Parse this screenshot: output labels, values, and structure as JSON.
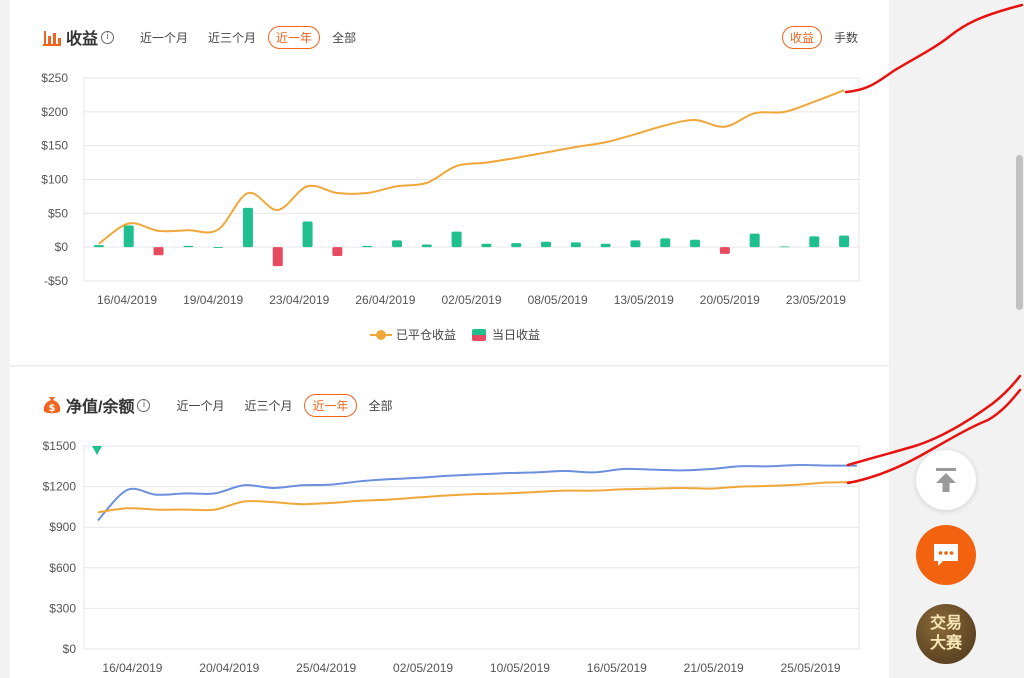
{
  "income_panel": {
    "title": "收益",
    "info": "i",
    "tabs": [
      "近一个月",
      "近三个月",
      "近一年",
      "全部"
    ],
    "active_tab": 2,
    "toggle": [
      "收益",
      "手数"
    ],
    "active_toggle": 0,
    "legend": [
      "已平仓收益",
      "当日收益"
    ]
  },
  "nav_panel": {
    "title": "净值/余额",
    "info": "i",
    "tabs": [
      "近一个月",
      "近三个月",
      "近一年",
      "全部"
    ],
    "active_tab": 2
  },
  "float_buttons": {
    "contest_line1": "交易",
    "contest_line2": "大赛"
  },
  "colors": {
    "accent": "#f0651f",
    "closed_income": "#f0a73a",
    "positive_bar": "#1fbf8f",
    "negative_bar": "#e84a5f",
    "net_value": "#6b8fdc",
    "balance": "#f0a73a",
    "annotation": "#e8110e"
  },
  "chart_data": [
    {
      "type": "bar",
      "y_tick_labels": [
        "$250",
        "$200",
        "$150",
        "$100",
        "$50",
        "$0",
        "-$50"
      ],
      "ylim": [
        -50,
        250
      ],
      "x_tick_labels": [
        "16/04/2019",
        "19/04/2019",
        "23/04/2019",
        "26/04/2019",
        "02/05/2019",
        "08/05/2019",
        "13/05/2019",
        "20/05/2019",
        "23/05/2019"
      ],
      "legend_position": "bottom",
      "grid": true,
      "series": [
        {
          "name": "已平仓收益",
          "type": "line",
          "values": [
            5,
            35,
            24,
            25,
            26,
            80,
            55,
            90,
            80,
            80,
            90,
            95,
            120,
            125,
            132,
            140,
            148,
            155,
            167,
            180,
            188,
            178,
            198,
            200,
            215,
            232
          ]
        },
        {
          "name": "当日收益",
          "type": "bar",
          "values": [
            3,
            32,
            -12,
            2,
            0,
            58,
            -28,
            38,
            -13,
            2,
            10,
            4,
            23,
            5,
            6,
            8,
            7,
            5,
            10,
            13,
            11,
            -10,
            20,
            1,
            16,
            17
          ]
        }
      ]
    },
    {
      "type": "line",
      "y_tick_labels": [
        "$1500",
        "$1200",
        "$900",
        "$600",
        "$300",
        "$0"
      ],
      "ylim": [
        0,
        1500
      ],
      "x_tick_labels": [
        "16/04/2019",
        "20/04/2019",
        "25/04/2019",
        "02/05/2019",
        "10/05/2019",
        "16/05/2019",
        "21/05/2019",
        "25/05/2019"
      ],
      "grid": true,
      "series": [
        {
          "values": [
            950,
            1175,
            1140,
            1150,
            1150,
            1210,
            1190,
            1210,
            1215,
            1240,
            1255,
            1265,
            1280,
            1290,
            1300,
            1305,
            1315,
            1305,
            1330,
            1325,
            1320,
            1330,
            1350,
            1350,
            1360,
            1355,
            1355
          ]
        },
        {
          "values": [
            1010,
            1040,
            1030,
            1030,
            1030,
            1090,
            1085,
            1070,
            1080,
            1095,
            1105,
            1120,
            1135,
            1145,
            1150,
            1160,
            1170,
            1170,
            1180,
            1185,
            1190,
            1185,
            1200,
            1205,
            1215,
            1230,
            1235
          ]
        }
      ]
    }
  ]
}
